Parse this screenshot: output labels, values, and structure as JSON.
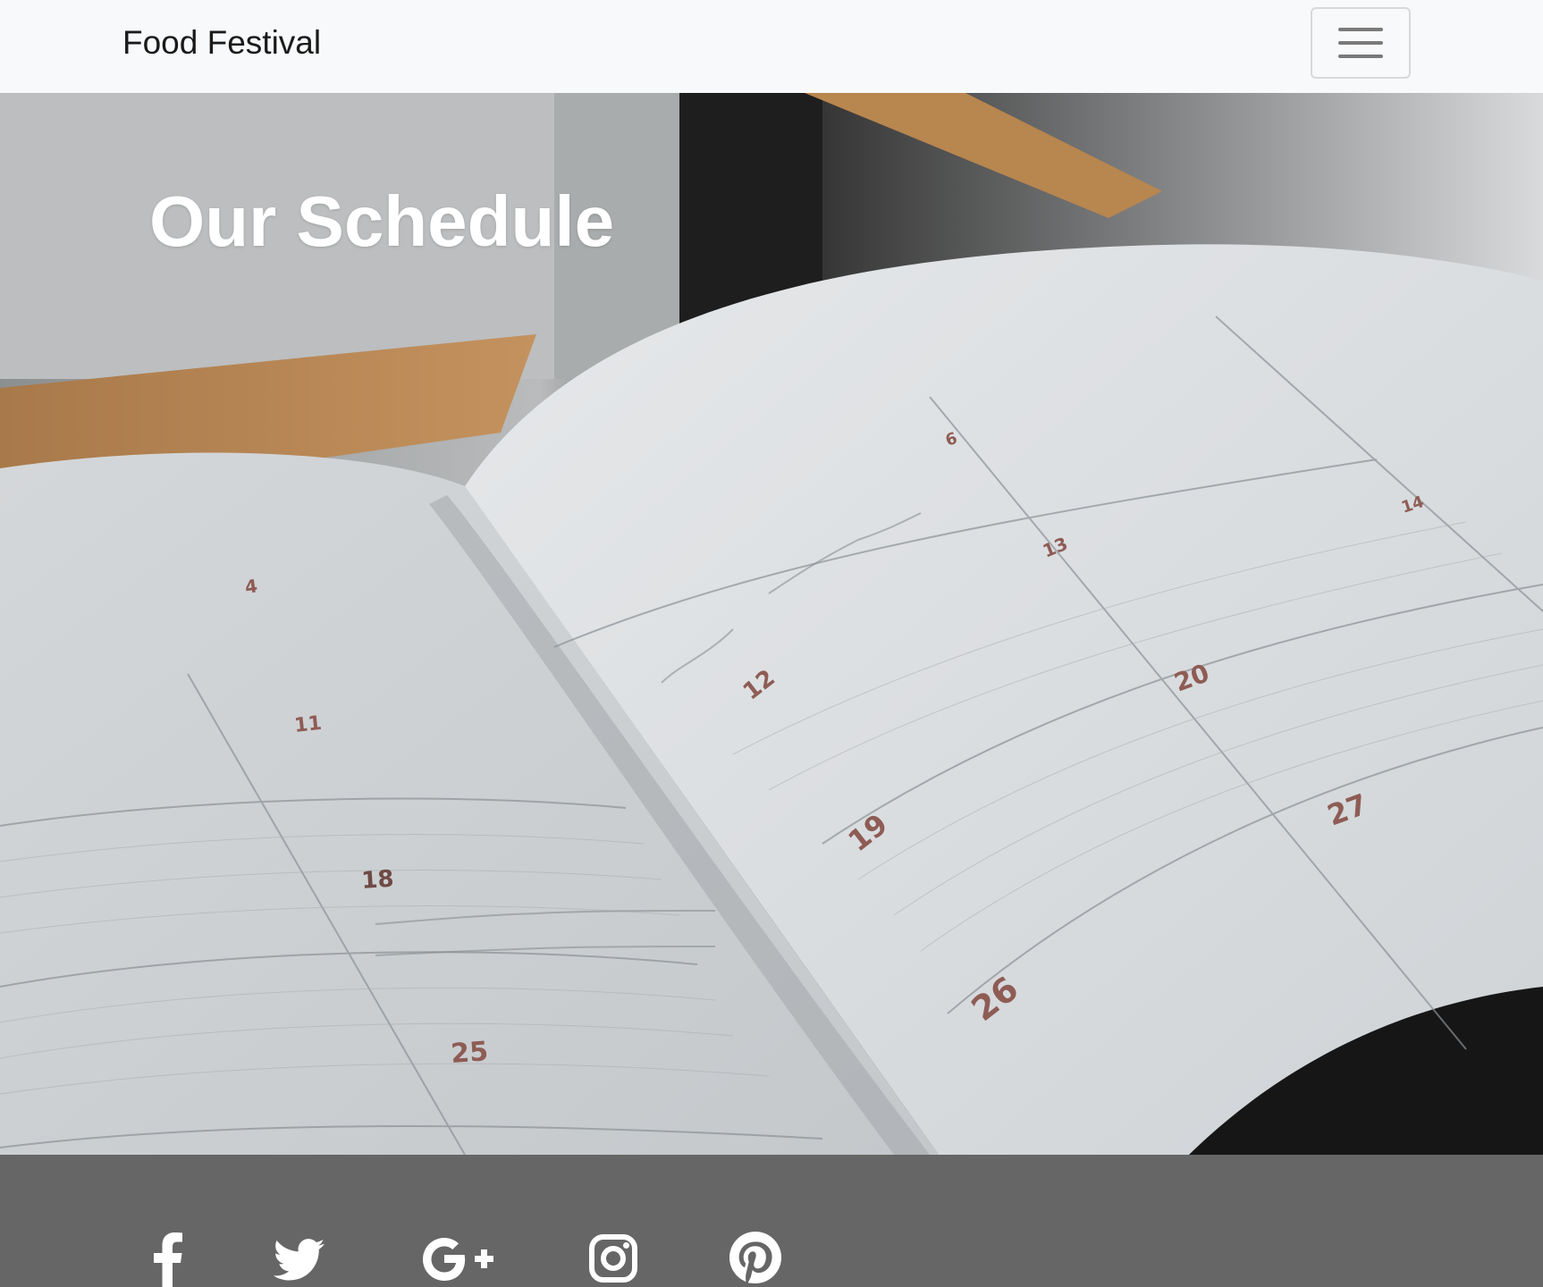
{
  "navbar": {
    "brand": "Food Festival",
    "toggler_icon": "hamburger-menu-icon"
  },
  "hero": {
    "title": "Our Schedule",
    "background_image": "open planner calendar photo",
    "calendar_numbers": [
      "4",
      "11",
      "18",
      "25",
      "12",
      "19",
      "26",
      "13",
      "20",
      "27",
      "14",
      "6"
    ]
  },
  "footer": {
    "social_icons": [
      "facebook-icon",
      "twitter-icon",
      "google-plus-icon",
      "instagram-icon",
      "pinterest-icon"
    ]
  },
  "colors": {
    "navbar_bg": "#f8f9fa",
    "footer_bg": "#666666",
    "icon_color": "#ffffff",
    "title_color": "#ffffff"
  }
}
